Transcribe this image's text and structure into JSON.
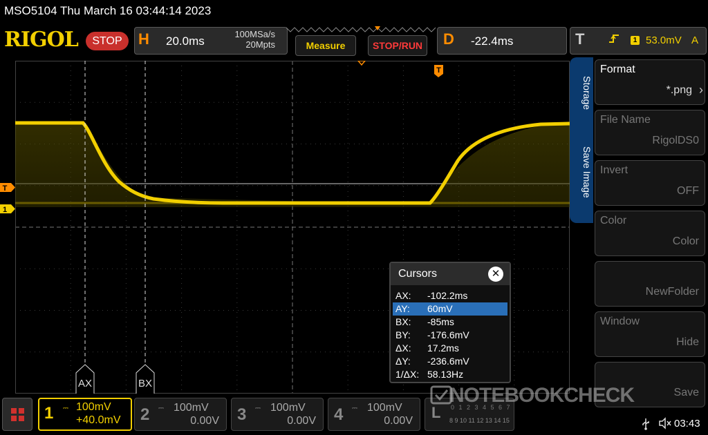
{
  "header": {
    "title": "MSO5104  Thu March 16 03:44:14 2023",
    "brand": "RIGOL",
    "run_state": "STOP"
  },
  "horizontal": {
    "letter": "H",
    "timebase": "20.0ms",
    "sample_rate": "100MSa/s",
    "memory_depth": "20Mpts"
  },
  "buttons": {
    "measure": "Measure",
    "stop_run": "STOP/RUN"
  },
  "delay": {
    "letter": "D",
    "value": "-22.4ms"
  },
  "trigger": {
    "letter": "T",
    "edge_icon": "rising-edge-icon",
    "source": "1",
    "level": "53.0mV",
    "mode": "A"
  },
  "markers": {
    "trigger_level": "T",
    "channel1": "1",
    "trigger_position": "T"
  },
  "cursor_labels": {
    "a": "AX",
    "b": "BX"
  },
  "cursors": {
    "title": "Cursors",
    "close_icon": "close-icon",
    "rows": [
      {
        "key": "AX:",
        "value": "-102.2ms",
        "selected": false
      },
      {
        "key": "AY:",
        "value": "60mV",
        "selected": true
      },
      {
        "key": "BX:",
        "value": "-85ms",
        "selected": false
      },
      {
        "key": "BY:",
        "value": "-176.6mV",
        "selected": false
      },
      {
        "key": "ΔX:",
        "value": "17.2ms",
        "selected": false
      },
      {
        "key": "ΔY:",
        "value": "-236.6mV",
        "selected": false
      },
      {
        "key": "1/ΔX:",
        "value": "58.13Hz",
        "selected": false
      }
    ]
  },
  "menu": {
    "tab_storage": "Storage",
    "tab_save_image": "Save Image",
    "items": [
      {
        "label": "Format",
        "value": "*.png",
        "enabled": true
      },
      {
        "label": "File Name",
        "value": "RigolDS0",
        "enabled": false
      },
      {
        "label": "Invert",
        "value": "OFF",
        "enabled": false
      },
      {
        "label": "Color",
        "value": "Color",
        "enabled": false
      },
      {
        "label": "",
        "value": "NewFolder",
        "enabled": false
      },
      {
        "label": "Window",
        "value": "Hide",
        "enabled": false
      },
      {
        "label": "",
        "value": "Save",
        "enabled": false
      }
    ]
  },
  "channels": [
    {
      "num": "1",
      "coupling": "DC",
      "scale": "100mV",
      "offset": "+40.0mV",
      "active": true,
      "color": "#f2cf00"
    },
    {
      "num": "2",
      "coupling": "DC",
      "scale": "100mV",
      "offset": "0.00V",
      "active": false
    },
    {
      "num": "3",
      "coupling": "DC",
      "scale": "100mV",
      "offset": "0.00V",
      "active": false
    },
    {
      "num": "4",
      "coupling": "DC",
      "scale": "100mV",
      "offset": "0.00V",
      "active": false
    }
  ],
  "logic": {
    "letter": "L",
    "row1": "0 1 2 3 4 5 6 7",
    "row2": "8 9 10 11 12 13 14 15"
  },
  "watermark": "NOTEBOOKCHECK",
  "status": {
    "usb_icon": "usb-icon",
    "speaker_icon": "speaker-muted-icon",
    "time": "03:43"
  },
  "colors": {
    "ch1": "#f2cf00",
    "trigger": "#ff8c00",
    "stop": "#c9302c",
    "menu_tab": "#0b3a6e",
    "selected_row": "#2a6fb8"
  }
}
